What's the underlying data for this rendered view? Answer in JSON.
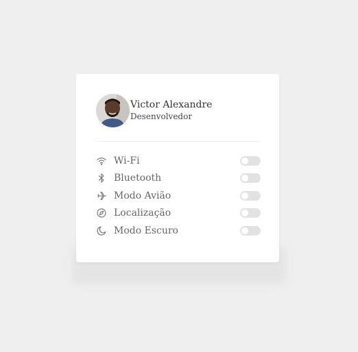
{
  "profile": {
    "name": "Victor Alexandre",
    "role": "Desenvolvedor"
  },
  "settings": [
    {
      "label": "Wi-Fi",
      "icon": "wifi-icon",
      "enabled": false
    },
    {
      "label": "Bluetooth",
      "icon": "bluetooth-icon",
      "enabled": false
    },
    {
      "label": "Modo Avião",
      "icon": "airplane-icon",
      "enabled": false
    },
    {
      "label": "Localização",
      "icon": "compass-icon",
      "enabled": false
    },
    {
      "label": "Modo Escuro",
      "icon": "moon-icon",
      "enabled": false
    }
  ],
  "colors": {
    "background": "#efefef",
    "card": "#ffffff",
    "toggle_off": "#e2e2e2",
    "icon": "#777777"
  }
}
